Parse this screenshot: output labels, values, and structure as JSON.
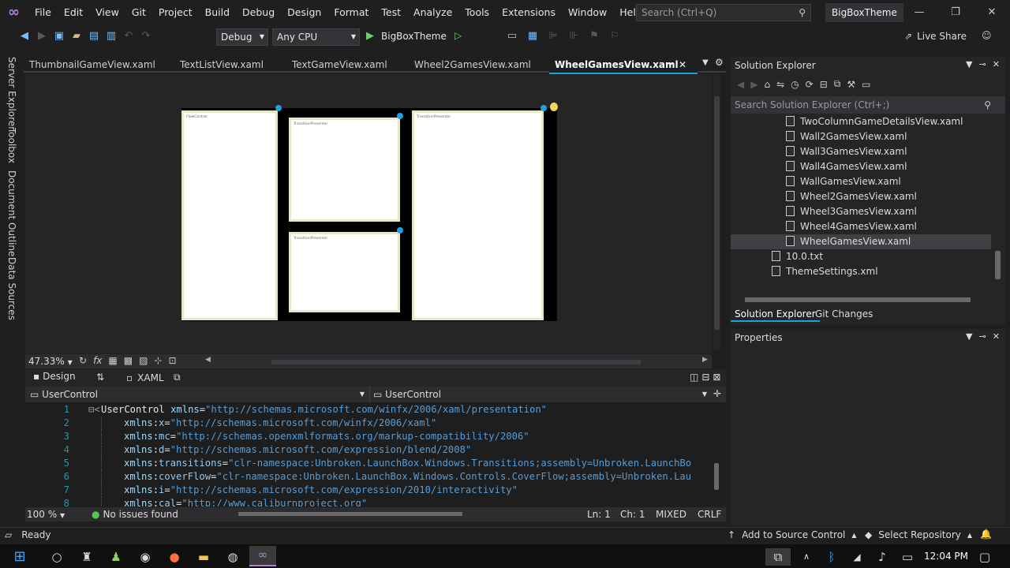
{
  "titlebar": {
    "menu": [
      "File",
      "Edit",
      "View",
      "Git",
      "Project",
      "Build",
      "Debug",
      "Design",
      "Format",
      "Test",
      "Analyze",
      "Tools",
      "Extensions",
      "Window",
      "Help"
    ],
    "search_placeholder": "Search (Ctrl+Q)",
    "solution_name": "BigBoxTheme"
  },
  "toolbar": {
    "config": "Debug",
    "platform": "Any CPU",
    "start_target": "BigBoxTheme",
    "live_share": "Live Share"
  },
  "left_rail": [
    "Server Explorer",
    "Toolbox",
    "Document Outline",
    "Data Sources"
  ],
  "tabs": [
    {
      "label": "ThumbnailGameView.xaml",
      "active": false
    },
    {
      "label": "TextListView.xaml",
      "active": false
    },
    {
      "label": "TextGameView.xaml",
      "active": false
    },
    {
      "label": "Wheel2GamesView.xaml",
      "active": false
    },
    {
      "label": "WheelGamesView.xaml",
      "active": true
    }
  ],
  "designer": {
    "panels": [
      "FlowControl",
      "TransitionPresenter",
      "TransitionPresenter",
      "TransitionPresenter"
    ],
    "zoom": "47.33%"
  },
  "split": {
    "design": "Design",
    "xaml": "XAML"
  },
  "nav": {
    "left": "UserControl",
    "right": "UserControl"
  },
  "code": [
    {
      "n": "1",
      "indent": "",
      "parts": [
        [
          "tag",
          "UserControl "
        ],
        [
          "attr",
          "xmlns"
        ],
        [
          "tag",
          "="
        ],
        [
          "val",
          "\"http://schemas.microsoft.com/winfx/2006/xaml/presentation\""
        ]
      ]
    },
    {
      "n": "2",
      "indent": "    ",
      "parts": [
        [
          "attr",
          "xmlns"
        ],
        [
          "tag",
          ":"
        ],
        [
          "attr2",
          "x"
        ],
        [
          "tag",
          "="
        ],
        [
          "val",
          "\"http://schemas.microsoft.com/winfx/2006/xaml\""
        ]
      ]
    },
    {
      "n": "3",
      "indent": "    ",
      "parts": [
        [
          "attr",
          "xmlns"
        ],
        [
          "tag",
          ":"
        ],
        [
          "attr2",
          "mc"
        ],
        [
          "tag",
          "="
        ],
        [
          "val",
          "\"http://schemas.openxmlformats.org/markup-compatibility/2006\""
        ]
      ]
    },
    {
      "n": "4",
      "indent": "    ",
      "parts": [
        [
          "attr",
          "xmlns"
        ],
        [
          "tag",
          ":"
        ],
        [
          "attr2",
          "d"
        ],
        [
          "tag",
          "="
        ],
        [
          "val",
          "\"http://schemas.microsoft.com/expression/blend/2008\""
        ]
      ]
    },
    {
      "n": "5",
      "indent": "    ",
      "parts": [
        [
          "attr",
          "xmlns"
        ],
        [
          "tag",
          ":"
        ],
        [
          "attr2",
          "transitions"
        ],
        [
          "tag",
          "="
        ],
        [
          "val",
          "\"clr-namespace:Unbroken.LaunchBox.Windows.Transitions;assembly=Unbroken.LaunchBo"
        ]
      ]
    },
    {
      "n": "6",
      "indent": "    ",
      "parts": [
        [
          "attr",
          "xmlns"
        ],
        [
          "tag",
          ":"
        ],
        [
          "attr2",
          "coverFlow"
        ],
        [
          "tag",
          "="
        ],
        [
          "val",
          "\"clr-namespace:Unbroken.LaunchBox.Windows.Controls.CoverFlow;assembly=Unbroken.Lau"
        ]
      ]
    },
    {
      "n": "7",
      "indent": "    ",
      "parts": [
        [
          "attr",
          "xmlns"
        ],
        [
          "tag",
          ":"
        ],
        [
          "attr2",
          "i"
        ],
        [
          "tag",
          "="
        ],
        [
          "val",
          "\"http://schemas.microsoft.com/expression/2010/interactivity\""
        ]
      ]
    },
    {
      "n": "8",
      "indent": "    ",
      "parts": [
        [
          "attr",
          "xmlns"
        ],
        [
          "tag",
          ":"
        ],
        [
          "attr2",
          "cal"
        ],
        [
          "tag",
          "="
        ],
        [
          "val",
          "\"http://www.caliburnproject.org\""
        ]
      ]
    }
  ],
  "editor_status": {
    "zoom": "100 %",
    "issues": "No issues found",
    "ln": "Ln: 1",
    "ch": "Ch: 1",
    "mode": "MIXED",
    "eol": "CRLF"
  },
  "solution_explorer": {
    "title": "Solution Explorer",
    "search_placeholder": "Search Solution Explorer (Ctrl+;)",
    "items": [
      "TwoColumnGameDetailsView.xaml",
      "Wall2GamesView.xaml",
      "Wall3GamesView.xaml",
      "Wall4GamesView.xaml",
      "WallGamesView.xaml",
      "Wheel2GamesView.xaml",
      "Wheel3GamesView.xaml",
      "Wheel4GamesView.xaml",
      "WheelGamesView.xaml"
    ],
    "root_items": [
      "10.0.txt",
      "ThemeSettings.xml"
    ],
    "tabs": [
      "Solution Explorer",
      "Git Changes"
    ]
  },
  "properties": {
    "title": "Properties"
  },
  "statusbar": {
    "ready": "Ready",
    "source_control": "Add to Source Control",
    "repository": "Select Repository"
  },
  "taskbar": {
    "time": "12:04 PM"
  }
}
